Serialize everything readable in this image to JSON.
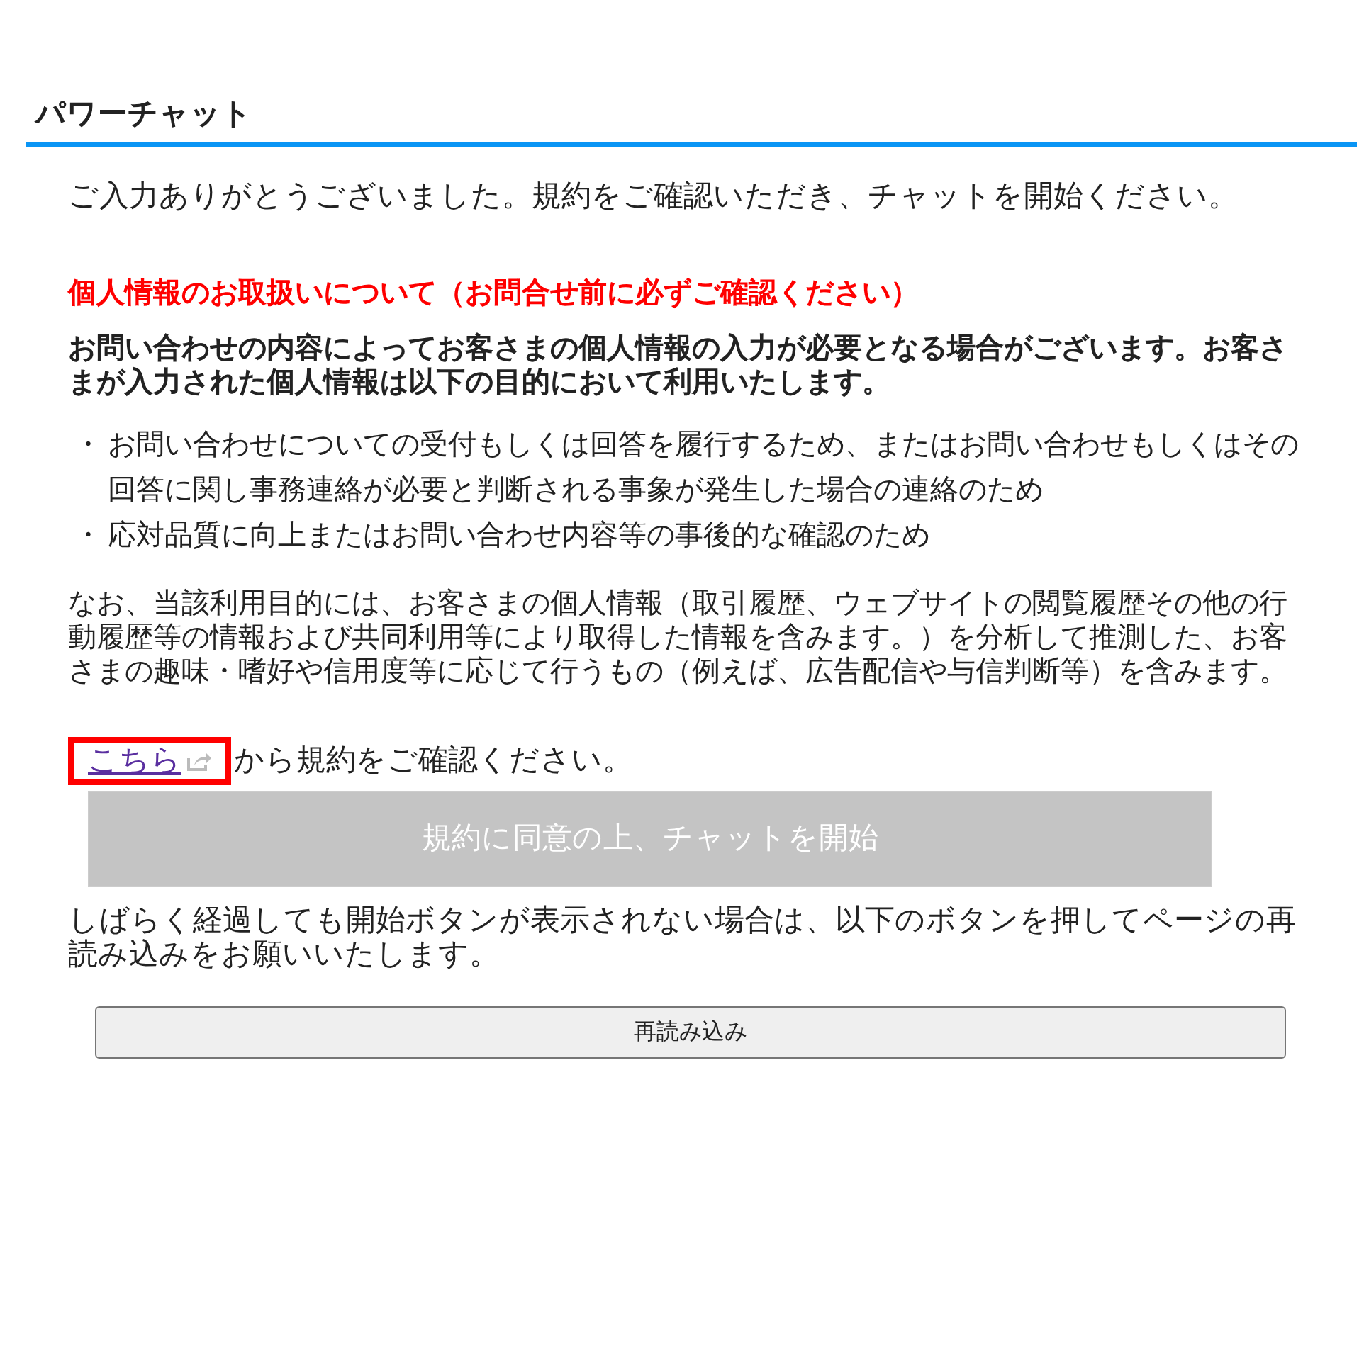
{
  "title": "パワーチャット",
  "intro": "ご入力ありがとうございました。規約をご確認いただき、チャットを開始ください。",
  "notice_heading": "個人情報のお取扱いについて（お問合せ前に必ずご確認ください）",
  "notice_lead": "お問い合わせの内容によってお客さまの個人情報の入力が必要となる場合がございます。お客さまが入力された個人情報は以下の目的において利用いたします。",
  "purposes": [
    {
      "bullet": "・",
      "text": "お問い合わせについての受付もしくは回答を履行するため、またはお問い合わせもしくはその回答に関し事務連絡が必要と判断される事象が発生した場合の連絡のため"
    },
    {
      "bullet": "・",
      "text": "応対品質に向上またはお問い合わせ内容等の事後的な確認のため"
    }
  ],
  "note": "なお、当該利用目的には、お客さまの個人情報（取引履歴、ウェブサイトの閲覧履歴その他の行動履歴等の情報および共同利用等により取得した情報を含みます。）を分析して推測した、お客さまの趣味・嗜好や信用度等に応じて行うもの（例えば、広告配信や与信判断等）を含みます。",
  "terms_link": {
    "label": "こちら",
    "highlighted": true
  },
  "terms_text": "から規約をご確認ください。",
  "start_button": {
    "label": "規約に同意の上、チャットを開始",
    "disabled": true
  },
  "reload_note": "しばらく経過しても開始ボタンが表示されない場合は、以下のボタンを押してページの再読み込みをお願いいたします。",
  "reload_button": {
    "label": "再読み込み"
  }
}
